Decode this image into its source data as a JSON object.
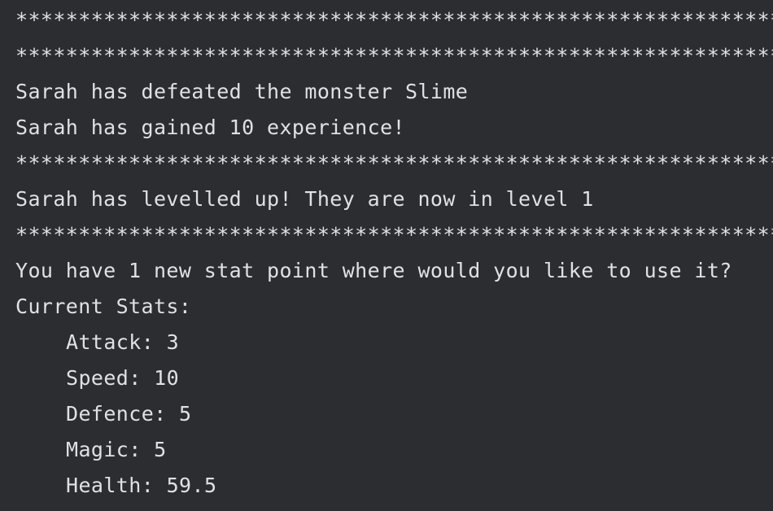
{
  "console": {
    "separator": "*******************************************************************",
    "defeat_message": "Sarah has defeated the monster Slime",
    "experience_message": "Sarah has gained 10 experience!",
    "levelup_message": "Sarah has levelled up! They are now in level 1",
    "stat_point_prompt": "You have 1 new stat point where would you like to use it?",
    "current_stats_heading": "Current Stats:",
    "stats": [
      "Attack: 3",
      "Speed: 10",
      "Defence: 5",
      "Magic: 5",
      "Health: 59.5"
    ]
  },
  "colors": {
    "background": "#2b2d30",
    "text": "#dfe1e5"
  }
}
